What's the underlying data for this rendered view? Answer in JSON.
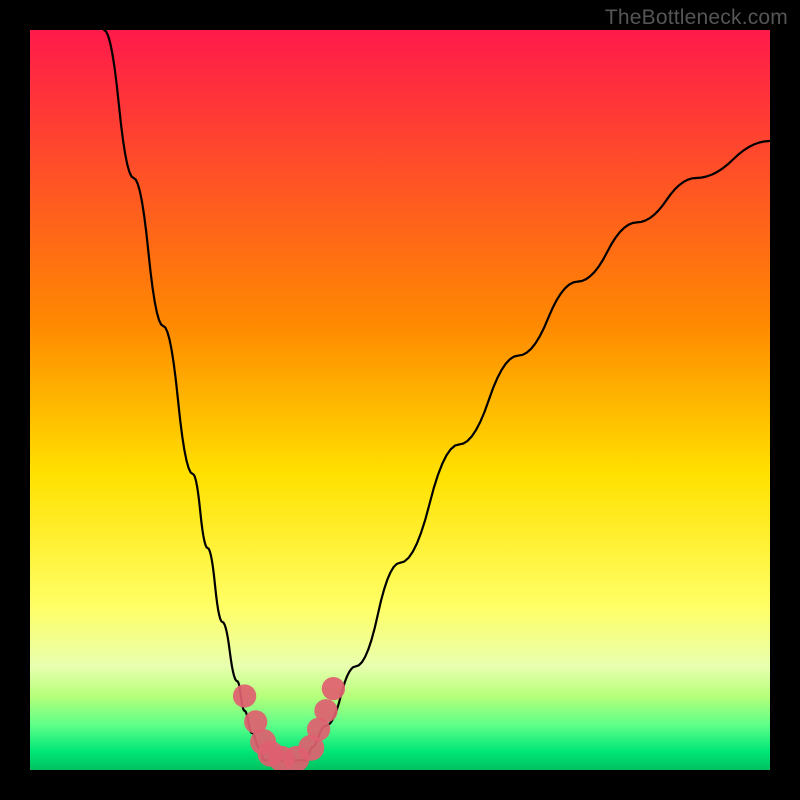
{
  "watermark": "TheBottleneck.com",
  "chart_data": {
    "type": "line",
    "title": "",
    "xlabel": "",
    "ylabel": "",
    "xlim": [
      0,
      100
    ],
    "ylim": [
      0,
      100
    ],
    "gradient_stops": [
      {
        "offset": 0.0,
        "color": "#ff1a4b"
      },
      {
        "offset": 0.4,
        "color": "#ff8a00"
      },
      {
        "offset": 0.6,
        "color": "#ffe100"
      },
      {
        "offset": 0.78,
        "color": "#ffff66"
      },
      {
        "offset": 0.86,
        "color": "#e8ffb0"
      },
      {
        "offset": 0.9,
        "color": "#b6ff7a"
      },
      {
        "offset": 0.94,
        "color": "#5cff8a"
      },
      {
        "offset": 0.975,
        "color": "#00e676"
      },
      {
        "offset": 1.0,
        "color": "#00c060"
      }
    ],
    "series": [
      {
        "name": "left_limb",
        "x": [
          10,
          14,
          18,
          22,
          24,
          26,
          28,
          29,
          30,
          31
        ],
        "values": [
          100,
          80,
          60,
          40,
          30,
          20,
          12,
          8,
          5,
          3
        ]
      },
      {
        "name": "right_limb",
        "x": [
          38,
          40,
          44,
          50,
          58,
          66,
          74,
          82,
          90,
          100
        ],
        "values": [
          3,
          6,
          14,
          28,
          44,
          56,
          66,
          74,
          80,
          85
        ]
      }
    ],
    "markers": [
      {
        "x": 29.0,
        "y": 10.0,
        "r": 1.0
      },
      {
        "x": 30.5,
        "y": 6.5,
        "r": 1.0
      },
      {
        "x": 31.5,
        "y": 3.8,
        "r": 1.2
      },
      {
        "x": 32.5,
        "y": 2.2,
        "r": 1.2
      },
      {
        "x": 34.0,
        "y": 1.5,
        "r": 1.2
      },
      {
        "x": 36.0,
        "y": 1.5,
        "r": 1.2
      },
      {
        "x": 38.0,
        "y": 3.0,
        "r": 1.2
      },
      {
        "x": 39.0,
        "y": 5.5,
        "r": 1.0
      },
      {
        "x": 40.0,
        "y": 8.0,
        "r": 1.0
      },
      {
        "x": 41.0,
        "y": 11.0,
        "r": 1.0
      }
    ],
    "marker_color": "#e06070",
    "curve_color": "#000000",
    "curve_width": 2.2
  }
}
